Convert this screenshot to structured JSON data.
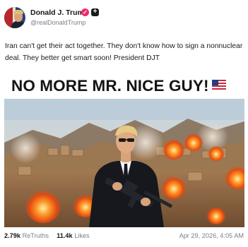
{
  "author": {
    "name": "Donald J. Trump",
    "handle": "@realDonaldTrump",
    "verified_badge": "verified-badge-icon",
    "follow_icon": "plus-icon"
  },
  "post": {
    "text": "Iran can't get their act together. They don't know how to sign a nonnuclear deal. They better get smart soon! President DJT",
    "image": {
      "headline": "NO MORE MR. NICE GUY!",
      "headline_icon": "us-flag-icon"
    }
  },
  "stats": {
    "retruths_count": "2.79k",
    "retruths_label": "ReTruths",
    "likes_count": "11.4k",
    "likes_label": "Likes",
    "timestamp": "Apr 29, 2026, 4:05 AM"
  },
  "colors": {
    "badge": "#f02a6a",
    "text_primary": "#15161a",
    "text_secondary": "#7a7f89"
  }
}
